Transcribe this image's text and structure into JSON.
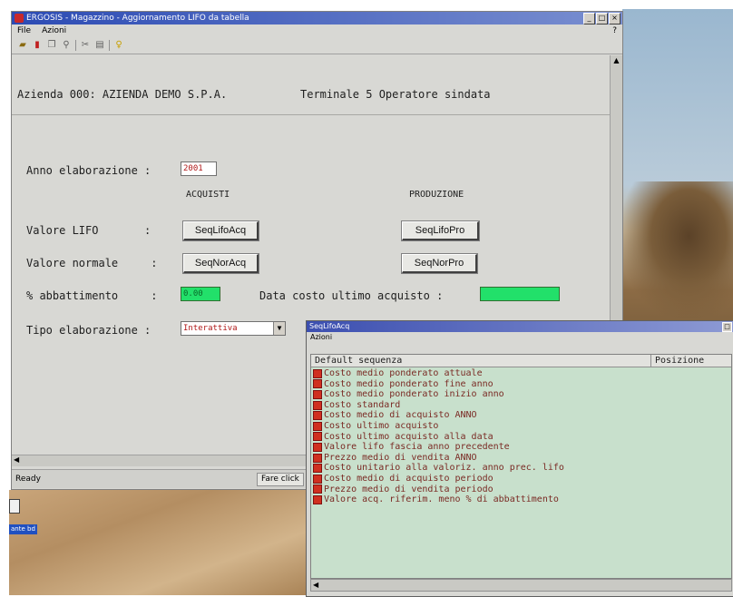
{
  "window": {
    "title": "ERGOSIS - Magazzino - Aggiornamento LIFO da tabella",
    "menu": [
      "File",
      "Azioni"
    ],
    "help": "?",
    "toolbar_icons": [
      "open-icon",
      "chart-icon",
      "copy-icon",
      "search-icon",
      "cut-icon",
      "print-icon",
      "help-icon"
    ]
  },
  "header": {
    "company": "Azienda 000: AZIENDA DEMO S.P.A.",
    "terminal": "Terminale  5 Operatore sindata"
  },
  "form": {
    "anno_label": "Anno elaborazione :",
    "anno_value": "2001",
    "col_acquisti": "ACQUISTI",
    "col_produzione": "PRODUZIONE",
    "lifo_label": "Valore LIFO       :",
    "btn_lifo_acq": "SeqLifoAcq",
    "btn_lifo_pro": "SeqLifoPro",
    "normale_label": "Valore normale     :",
    "btn_nor_acq": "SeqNorAcq",
    "btn_nor_pro": "SeqNorPro",
    "abbattimento_label": "% abbattimento     :",
    "abbattimento_value": "0.00",
    "data_costo_label": "Data costo ultimo acquisto :",
    "data_costo_value": "",
    "tipo_label": "Tipo elaborazione :",
    "tipo_value": "Interattiva"
  },
  "status": {
    "ready": "Ready",
    "hint": "Fare click"
  },
  "popup": {
    "title": "SeqLifoAcq",
    "menu": "Azioni",
    "col_default": "Default sequenza",
    "col_posizione": "Posizione",
    "items": [
      "Costo medio ponderato attuale",
      "Costo medio ponderato fine anno",
      "Costo medio ponderato inizio anno",
      "Costo standard",
      "Costo medio di acquisto ANNO",
      "Costo ultimo acquisto",
      "Costo ultimo acquisto alla data",
      "Valore lifo fascia anno precedente",
      "Prezzo medio di vendita ANNO",
      "Costo unitario alla valoriz. anno prec. lifo",
      "Costo medio di acquisto periodo",
      "Prezzo medio di vendita periodo",
      "Valore acq. riferim. meno % di abbattimento"
    ]
  },
  "desktop": {
    "icon_label": "ante bd"
  }
}
